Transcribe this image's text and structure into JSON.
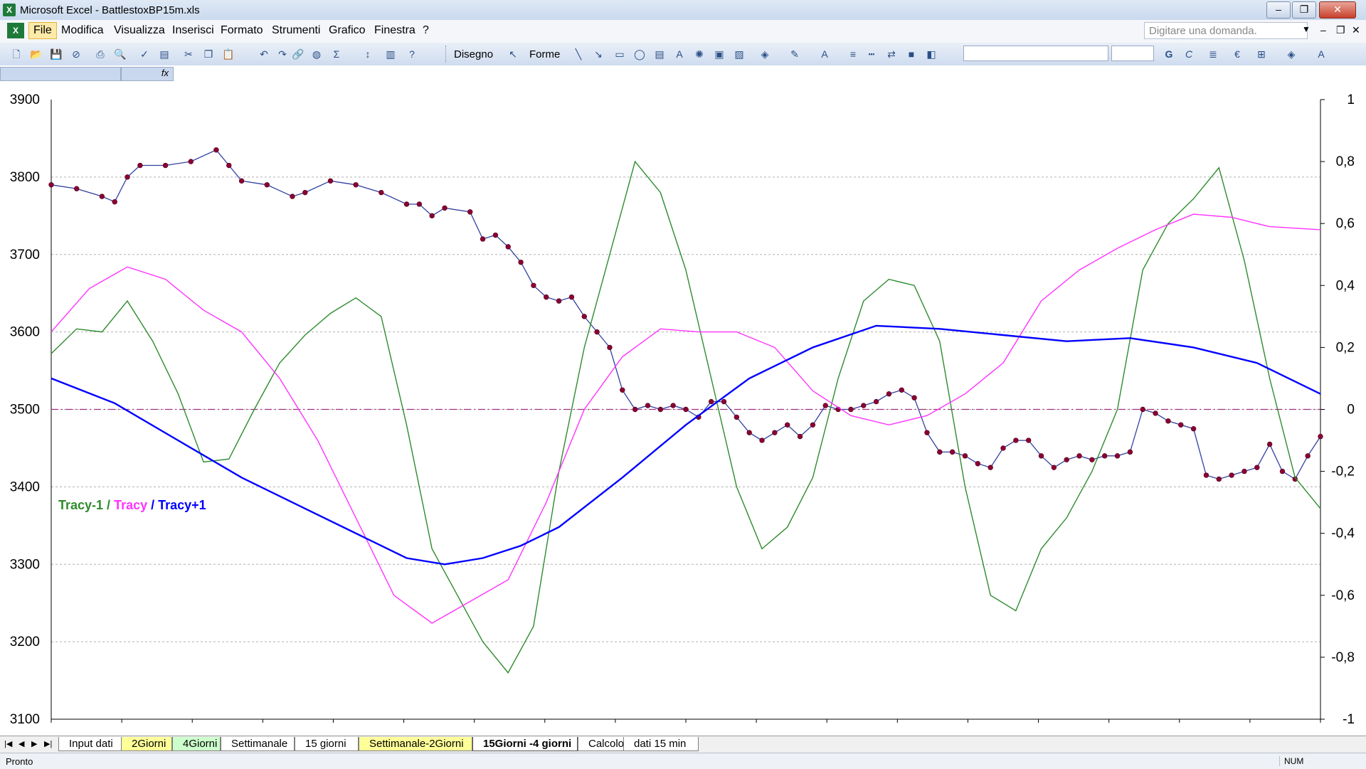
{
  "window": {
    "title": "Microsoft Excel - BattlestoxBP15m.xls",
    "minimize": "–",
    "restore": "❐",
    "close": "✕"
  },
  "menu": {
    "items": [
      "File",
      "Modifica",
      "Visualizza",
      "Inserisci",
      "Formato",
      "Strumenti",
      "Grafico",
      "Finestra",
      "?"
    ],
    "help_placeholder": "Digitare una domanda.",
    "mdi": {
      "minimize": "–",
      "restore": "❐",
      "close": "✕"
    }
  },
  "toolbar": {
    "draw_label": "Disegno",
    "shapes_label": "Forme"
  },
  "formula": {
    "fx": "fx"
  },
  "sheets": {
    "tabs": [
      {
        "label": "Input dati",
        "style": "white"
      },
      {
        "label": "2Giorni",
        "style": "yellow"
      },
      {
        "label": "4Giorni",
        "style": "green"
      },
      {
        "label": "Settimanale",
        "style": "white"
      },
      {
        "label": "15 giorni",
        "style": "white"
      },
      {
        "label": "Settimanale-2Giorni",
        "style": "yellow"
      },
      {
        "label": "15Giorni -4 giorni",
        "style": "active"
      },
      {
        "label": "Calcolo",
        "style": "white"
      },
      {
        "label": "dati 15 min",
        "style": "white"
      }
    ]
  },
  "status": {
    "text": "Pronto",
    "num": "NUM"
  },
  "chart_data": {
    "type": "line",
    "y_left": {
      "ylim": [
        3100,
        3900
      ],
      "ticks": [
        "3100",
        "3200",
        "3300",
        "3400",
        "3500",
        "3600",
        "3700",
        "3800",
        "3900"
      ]
    },
    "y_right": {
      "ylim": [
        -1,
        1
      ],
      "ticks": [
        "-1",
        "-0,8",
        "-0,6",
        "-0,4",
        "-0,2",
        "0",
        "0,2",
        "0,4",
        "0,6",
        "0,8",
        "1"
      ]
    },
    "grid": "horizontal dashed",
    "legend": {
      "position": "left",
      "parts": [
        "Tracy-1",
        " / ",
        "Tracy",
        " / ",
        "Tracy+1"
      ]
    },
    "colors": {
      "price": "#8b0032",
      "price_line": "#3040a0",
      "tracy_minus1": "#2e8b2e",
      "tracy": "#ff33ff",
      "tracy_plus1": "#0000ff",
      "zero_line": "#a03080"
    },
    "x_range": [
      0,
      100
    ],
    "series": [
      {
        "axis": "left",
        "style": "markers",
        "points": [
          [
            0,
            3790
          ],
          [
            2,
            3785
          ],
          [
            4,
            3775
          ],
          [
            5,
            3768
          ],
          [
            6,
            3800
          ],
          [
            7,
            3815
          ],
          [
            9,
            3815
          ],
          [
            11,
            3820
          ],
          [
            13,
            3835
          ],
          [
            14,
            3815
          ],
          [
            15,
            3795
          ],
          [
            17,
            3790
          ],
          [
            19,
            3775
          ],
          [
            20,
            3780
          ],
          [
            22,
            3795
          ],
          [
            24,
            3790
          ],
          [
            26,
            3780
          ],
          [
            28,
            3765
          ],
          [
            29,
            3765
          ],
          [
            30,
            3750
          ],
          [
            31,
            3760
          ],
          [
            33,
            3755
          ],
          [
            34,
            3720
          ],
          [
            35,
            3725
          ],
          [
            36,
            3710
          ],
          [
            37,
            3690
          ],
          [
            38,
            3660
          ],
          [
            39,
            3645
          ],
          [
            40,
            3640
          ],
          [
            41,
            3645
          ],
          [
            42,
            3620
          ],
          [
            43,
            3600
          ],
          [
            44,
            3580
          ],
          [
            45,
            3525
          ],
          [
            46,
            3500
          ],
          [
            47,
            3505
          ],
          [
            48,
            3500
          ],
          [
            49,
            3505
          ],
          [
            50,
            3500
          ],
          [
            51,
            3490
          ],
          [
            52,
            3510
          ],
          [
            53,
            3510
          ],
          [
            54,
            3490
          ],
          [
            55,
            3470
          ],
          [
            56,
            3460
          ],
          [
            57,
            3470
          ],
          [
            58,
            3480
          ],
          [
            59,
            3465
          ],
          [
            60,
            3480
          ],
          [
            61,
            3505
          ],
          [
            62,
            3500
          ],
          [
            63,
            3500
          ],
          [
            64,
            3505
          ],
          [
            65,
            3510
          ],
          [
            66,
            3520
          ],
          [
            67,
            3525
          ],
          [
            68,
            3515
          ],
          [
            69,
            3470
          ],
          [
            70,
            3445
          ],
          [
            71,
            3445
          ],
          [
            72,
            3440
          ],
          [
            73,
            3430
          ],
          [
            74,
            3425
          ],
          [
            75,
            3450
          ],
          [
            76,
            3460
          ],
          [
            77,
            3460
          ],
          [
            78,
            3440
          ],
          [
            79,
            3425
          ],
          [
            80,
            3435
          ],
          [
            81,
            3440
          ],
          [
            82,
            3435
          ],
          [
            83,
            3440
          ],
          [
            84,
            3440
          ],
          [
            85,
            3445
          ],
          [
            86,
            3500
          ],
          [
            87,
            3495
          ],
          [
            88,
            3485
          ],
          [
            89,
            3480
          ],
          [
            90,
            3475
          ],
          [
            91,
            3415
          ],
          [
            92,
            3410
          ],
          [
            93,
            3415
          ],
          [
            94,
            3420
          ],
          [
            95,
            3425
          ],
          [
            96,
            3455
          ],
          [
            97,
            3420
          ],
          [
            98,
            3410
          ],
          [
            99,
            3440
          ],
          [
            100,
            3465
          ]
        ]
      },
      {
        "axis": "right",
        "name": "Tracy-1",
        "color": "tracy_minus1",
        "points": [
          [
            0,
            0.18
          ],
          [
            2,
            0.26
          ],
          [
            4,
            0.25
          ],
          [
            6,
            0.35
          ],
          [
            8,
            0.22
          ],
          [
            10,
            0.05
          ],
          [
            12,
            -0.17
          ],
          [
            14,
            -0.16
          ],
          [
            16,
            0.0
          ],
          [
            18,
            0.15
          ],
          [
            20,
            0.24
          ],
          [
            22,
            0.31
          ],
          [
            24,
            0.36
          ],
          [
            26,
            0.3
          ],
          [
            28,
            -0.05
          ],
          [
            30,
            -0.45
          ],
          [
            32,
            -0.6
          ],
          [
            34,
            -0.75
          ],
          [
            36,
            -0.85
          ],
          [
            38,
            -0.7
          ],
          [
            40,
            -0.2
          ],
          [
            42,
            0.2
          ],
          [
            44,
            0.5
          ],
          [
            46,
            0.8
          ],
          [
            48,
            0.7
          ],
          [
            50,
            0.45
          ],
          [
            52,
            0.1
          ],
          [
            54,
            -0.25
          ],
          [
            56,
            -0.45
          ],
          [
            58,
            -0.38
          ],
          [
            60,
            -0.22
          ],
          [
            62,
            0.1
          ],
          [
            64,
            0.35
          ],
          [
            66,
            0.42
          ],
          [
            68,
            0.4
          ],
          [
            70,
            0.22
          ],
          [
            72,
            -0.25
          ],
          [
            74,
            -0.6
          ],
          [
            76,
            -0.65
          ],
          [
            78,
            -0.45
          ],
          [
            80,
            -0.35
          ],
          [
            82,
            -0.2
          ],
          [
            84,
            0.0
          ],
          [
            86,
            0.45
          ],
          [
            88,
            0.6
          ],
          [
            90,
            0.68
          ],
          [
            92,
            0.78
          ],
          [
            94,
            0.48
          ],
          [
            96,
            0.1
          ],
          [
            98,
            -0.22
          ],
          [
            100,
            -0.32
          ]
        ]
      },
      {
        "axis": "right",
        "name": "Tracy",
        "color": "tracy",
        "points": [
          [
            0,
            0.25
          ],
          [
            3,
            0.39
          ],
          [
            6,
            0.46
          ],
          [
            9,
            0.42
          ],
          [
            12,
            0.32
          ],
          [
            15,
            0.25
          ],
          [
            18,
            0.1
          ],
          [
            21,
            -0.1
          ],
          [
            24,
            -0.35
          ],
          [
            27,
            -0.6
          ],
          [
            30,
            -0.69
          ],
          [
            33,
            -0.62
          ],
          [
            36,
            -0.55
          ],
          [
            39,
            -0.3
          ],
          [
            42,
            0.0
          ],
          [
            45,
            0.17
          ],
          [
            48,
            0.26
          ],
          [
            51,
            0.25
          ],
          [
            54,
            0.25
          ],
          [
            57,
            0.2
          ],
          [
            60,
            0.06
          ],
          [
            63,
            -0.02
          ],
          [
            66,
            -0.05
          ],
          [
            69,
            -0.02
          ],
          [
            72,
            0.05
          ],
          [
            75,
            0.15
          ],
          [
            78,
            0.35
          ],
          [
            81,
            0.45
          ],
          [
            84,
            0.52
          ],
          [
            87,
            0.58
          ],
          [
            90,
            0.63
          ],
          [
            93,
            0.62
          ],
          [
            96,
            0.59
          ],
          [
            100,
            0.58
          ]
        ]
      },
      {
        "axis": "right",
        "name": "Tracy+1",
        "color": "tracy_plus1",
        "points": [
          [
            0,
            0.1
          ],
          [
            5,
            0.02
          ],
          [
            10,
            -0.1
          ],
          [
            15,
            -0.22
          ],
          [
            20,
            -0.32
          ],
          [
            25,
            -0.42
          ],
          [
            28,
            -0.48
          ],
          [
            31,
            -0.5
          ],
          [
            34,
            -0.48
          ],
          [
            37,
            -0.44
          ],
          [
            40,
            -0.38
          ],
          [
            45,
            -0.22
          ],
          [
            50,
            -0.05
          ],
          [
            55,
            0.1
          ],
          [
            60,
            0.2
          ],
          [
            65,
            0.27
          ],
          [
            70,
            0.26
          ],
          [
            75,
            0.24
          ],
          [
            80,
            0.22
          ],
          [
            85,
            0.23
          ],
          [
            90,
            0.2
          ],
          [
            95,
            0.15
          ],
          [
            100,
            0.05
          ]
        ]
      }
    ]
  }
}
